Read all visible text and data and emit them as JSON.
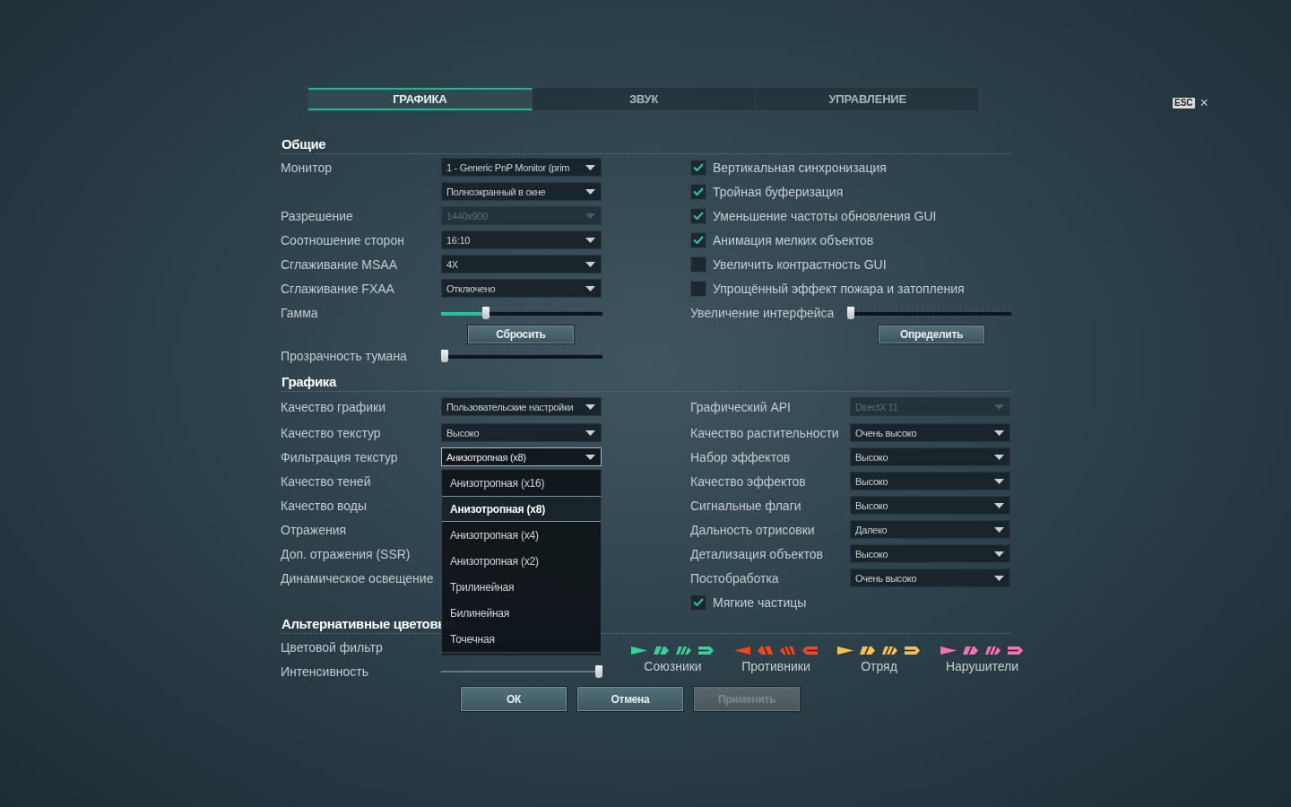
{
  "tabs": [
    {
      "label": "ГРАФИКА",
      "selected": true
    },
    {
      "label": "ЗВУК",
      "selected": false
    },
    {
      "label": "УПРАВЛЕНИЕ",
      "selected": false
    }
  ],
  "close": {
    "key": "ESC",
    "symbol": "×"
  },
  "general": {
    "title": "Общие",
    "left": [
      {
        "kind": "select",
        "label": "Монитор",
        "value": "1 - Generic PnP Monitor (prim",
        "disabled": false
      },
      {
        "kind": "select",
        "value": "Полноэкранный в окне",
        "disabled": false
      },
      {
        "kind": "select",
        "label": "Разрешение",
        "value": "1440x900",
        "disabled": true
      },
      {
        "kind": "select",
        "label": "Соотношение сторон",
        "value": "16:10",
        "disabled": false
      },
      {
        "kind": "select",
        "label": "Сглаживание MSAA",
        "value": "4X",
        "disabled": false
      },
      {
        "kind": "select",
        "label": "Сглаживание FXAA",
        "value": "Отключено",
        "disabled": false
      },
      {
        "kind": "slider",
        "label": "Гамма",
        "level": 0.28
      },
      {
        "kind": "button",
        "label": "Сбросить"
      },
      {
        "kind": "slider",
        "label": "Прозрачность тумана",
        "level": 0
      }
    ],
    "right": [
      {
        "kind": "check",
        "label": "Вертикальная синхронизация",
        "checked": true
      },
      {
        "kind": "check",
        "label": "Тройная буферизация",
        "checked": true
      },
      {
        "kind": "check",
        "label": "Уменьшение частоты обновления GUI",
        "checked": true
      },
      {
        "kind": "check",
        "label": "Анимация мелких объектов",
        "checked": true
      },
      {
        "kind": "check",
        "label": "Увеличить контрастность GUI",
        "checked": false
      },
      {
        "kind": "check",
        "label": "Упрощённый эффект пожара и затопления",
        "checked": false
      },
      {
        "kind": "slider",
        "label": "Увеличение интерфейса",
        "level": 0
      },
      {
        "kind": "button",
        "label": "Определить"
      }
    ]
  },
  "graphics": {
    "title": "Графика",
    "left": [
      {
        "kind": "select",
        "label": "Качество графики",
        "value": "Пользовательские настройки",
        "disabled": false,
        "open": false
      },
      {
        "kind": "select",
        "label": "Качество текстур",
        "value": "Высоко",
        "disabled": false,
        "open": false
      },
      {
        "kind": "select",
        "label": "Фильтрация текстур",
        "value": "Анизотропная (x8)",
        "disabled": false,
        "open": true,
        "options": [
          {
            "label": "Анизотропная (x16)",
            "selected": false
          },
          {
            "label": "Анизотропная (x8)",
            "selected": true
          },
          {
            "label": "Анизотропная (x4)",
            "selected": false
          },
          {
            "label": "Анизотропная (x2)",
            "selected": false
          },
          {
            "label": "Трилинейная",
            "selected": false
          },
          {
            "label": "Билинейная",
            "selected": false
          },
          {
            "label": "Точечная",
            "selected": false
          }
        ]
      },
      {
        "kind": "label",
        "label": "Качество теней"
      },
      {
        "kind": "label",
        "label": "Качество воды"
      },
      {
        "kind": "label",
        "label": "Отражения"
      },
      {
        "kind": "label",
        "label": "Доп. отражения (SSR)"
      },
      {
        "kind": "label",
        "label": "Динамическое освещение"
      }
    ],
    "right": [
      {
        "kind": "select",
        "label": "Графический API",
        "value": "DirectX 11",
        "disabled": true,
        "open": false
      },
      {
        "kind": "select",
        "label": "Качество растительности",
        "value": "Очень высоко",
        "disabled": false,
        "open": false
      },
      {
        "kind": "select",
        "label": "Набор эффектов",
        "value": "Высоко",
        "disabled": false,
        "open": false
      },
      {
        "kind": "select",
        "label": "Качество эффектов",
        "value": "Высоко",
        "disabled": false,
        "open": false
      },
      {
        "kind": "select",
        "label": "Сигнальные флаги",
        "value": "Высоко",
        "disabled": false,
        "open": false
      },
      {
        "kind": "select",
        "label": "Дальность отрисовки",
        "value": "Далеко",
        "disabled": false,
        "open": false
      },
      {
        "kind": "select",
        "label": "Детализация объектов",
        "value": "Высоко",
        "disabled": false,
        "open": false
      },
      {
        "kind": "select",
        "label": "Постобработка",
        "value": "Очень высоко",
        "disabled": false,
        "open": false
      },
      {
        "kind": "check",
        "label": "Мягкие частицы",
        "checked": true
      }
    ]
  },
  "color_filters": {
    "title": "Альтернативные цветовые",
    "left": [
      {
        "kind": "select",
        "label": "Цветовой фильтр",
        "disabled": false
      },
      {
        "kind": "thin-slider",
        "label": "Интенсивность",
        "level": 1
      }
    ],
    "legend": [
      {
        "label": "Союзники",
        "color": "#2fd49a",
        "kind": "forward"
      },
      {
        "label": "Противники",
        "color": "#ff4515",
        "kind": "reverse"
      },
      {
        "label": "Отряд",
        "color": "#ffc145",
        "kind": "forward"
      },
      {
        "label": "Нарушители",
        "color": "#ff6fb8",
        "kind": "forward"
      }
    ]
  },
  "buttons": [
    {
      "label": "ОК",
      "disabled": false
    },
    {
      "label": "Отмена",
      "disabled": false
    },
    {
      "label": "Применить",
      "disabled": true
    }
  ]
}
